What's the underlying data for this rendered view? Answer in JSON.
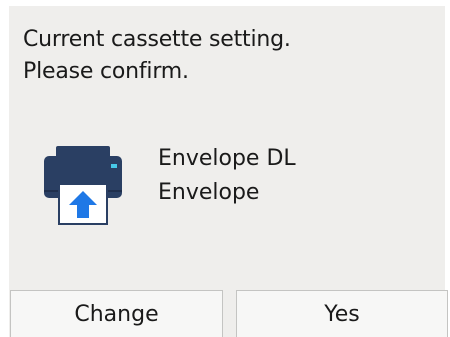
{
  "dialog": {
    "message_line1": "Current cassette setting.",
    "message_line2": "Please confirm."
  },
  "paper": {
    "icon": "printer-cassette-icon",
    "size": "Envelope DL",
    "type": "Envelope"
  },
  "buttons": {
    "change_label": "Change",
    "yes_label": "Yes"
  },
  "colors": {
    "panel_background": "#efeeec",
    "printer_body": "#2a3f63",
    "arrow": "#1f78e6",
    "indicator": "#47c8e8"
  }
}
